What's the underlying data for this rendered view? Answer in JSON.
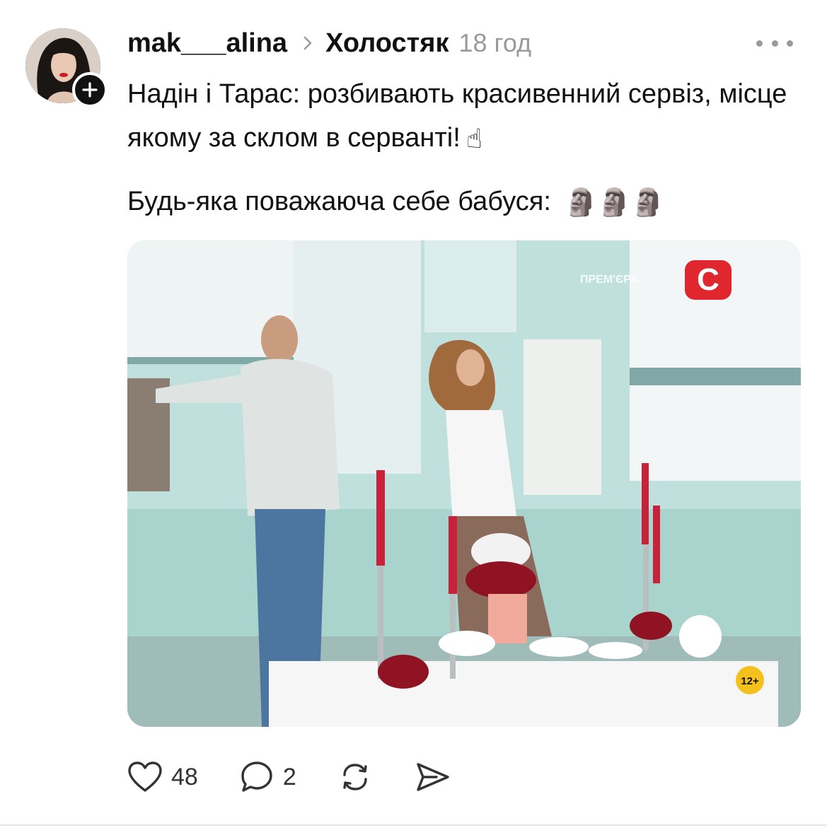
{
  "post": {
    "author": {
      "username": "mak___alina",
      "avatar_icon": "profile-photo",
      "follow_icon": "plus-icon"
    },
    "community": "Холостяк",
    "time": "18 год",
    "more_icon": "ellipsis-icon",
    "text": {
      "line1": "Надін і Тарас: розбивають красивенний сервіз, місце якому за склом в серванті!",
      "line1_emoji": "☝",
      "line2": "Будь-яка поважаюча себе бабуся:",
      "line2_emoji": "🗿🗿🗿"
    },
    "media": {
      "overlay_label": "ПРЕМ'ЄРА",
      "channel_logo": "C",
      "age_rating": "12+"
    },
    "actions": {
      "like_count": "48",
      "comment_count": "2",
      "like_icon": "heart-icon",
      "comment_icon": "comment-icon",
      "repost_icon": "repost-icon",
      "share_icon": "send-icon"
    }
  },
  "colors": {
    "text": "#111111",
    "muted": "#9a9a9a",
    "badge": "#111111",
    "channel_red": "#e0262f"
  }
}
